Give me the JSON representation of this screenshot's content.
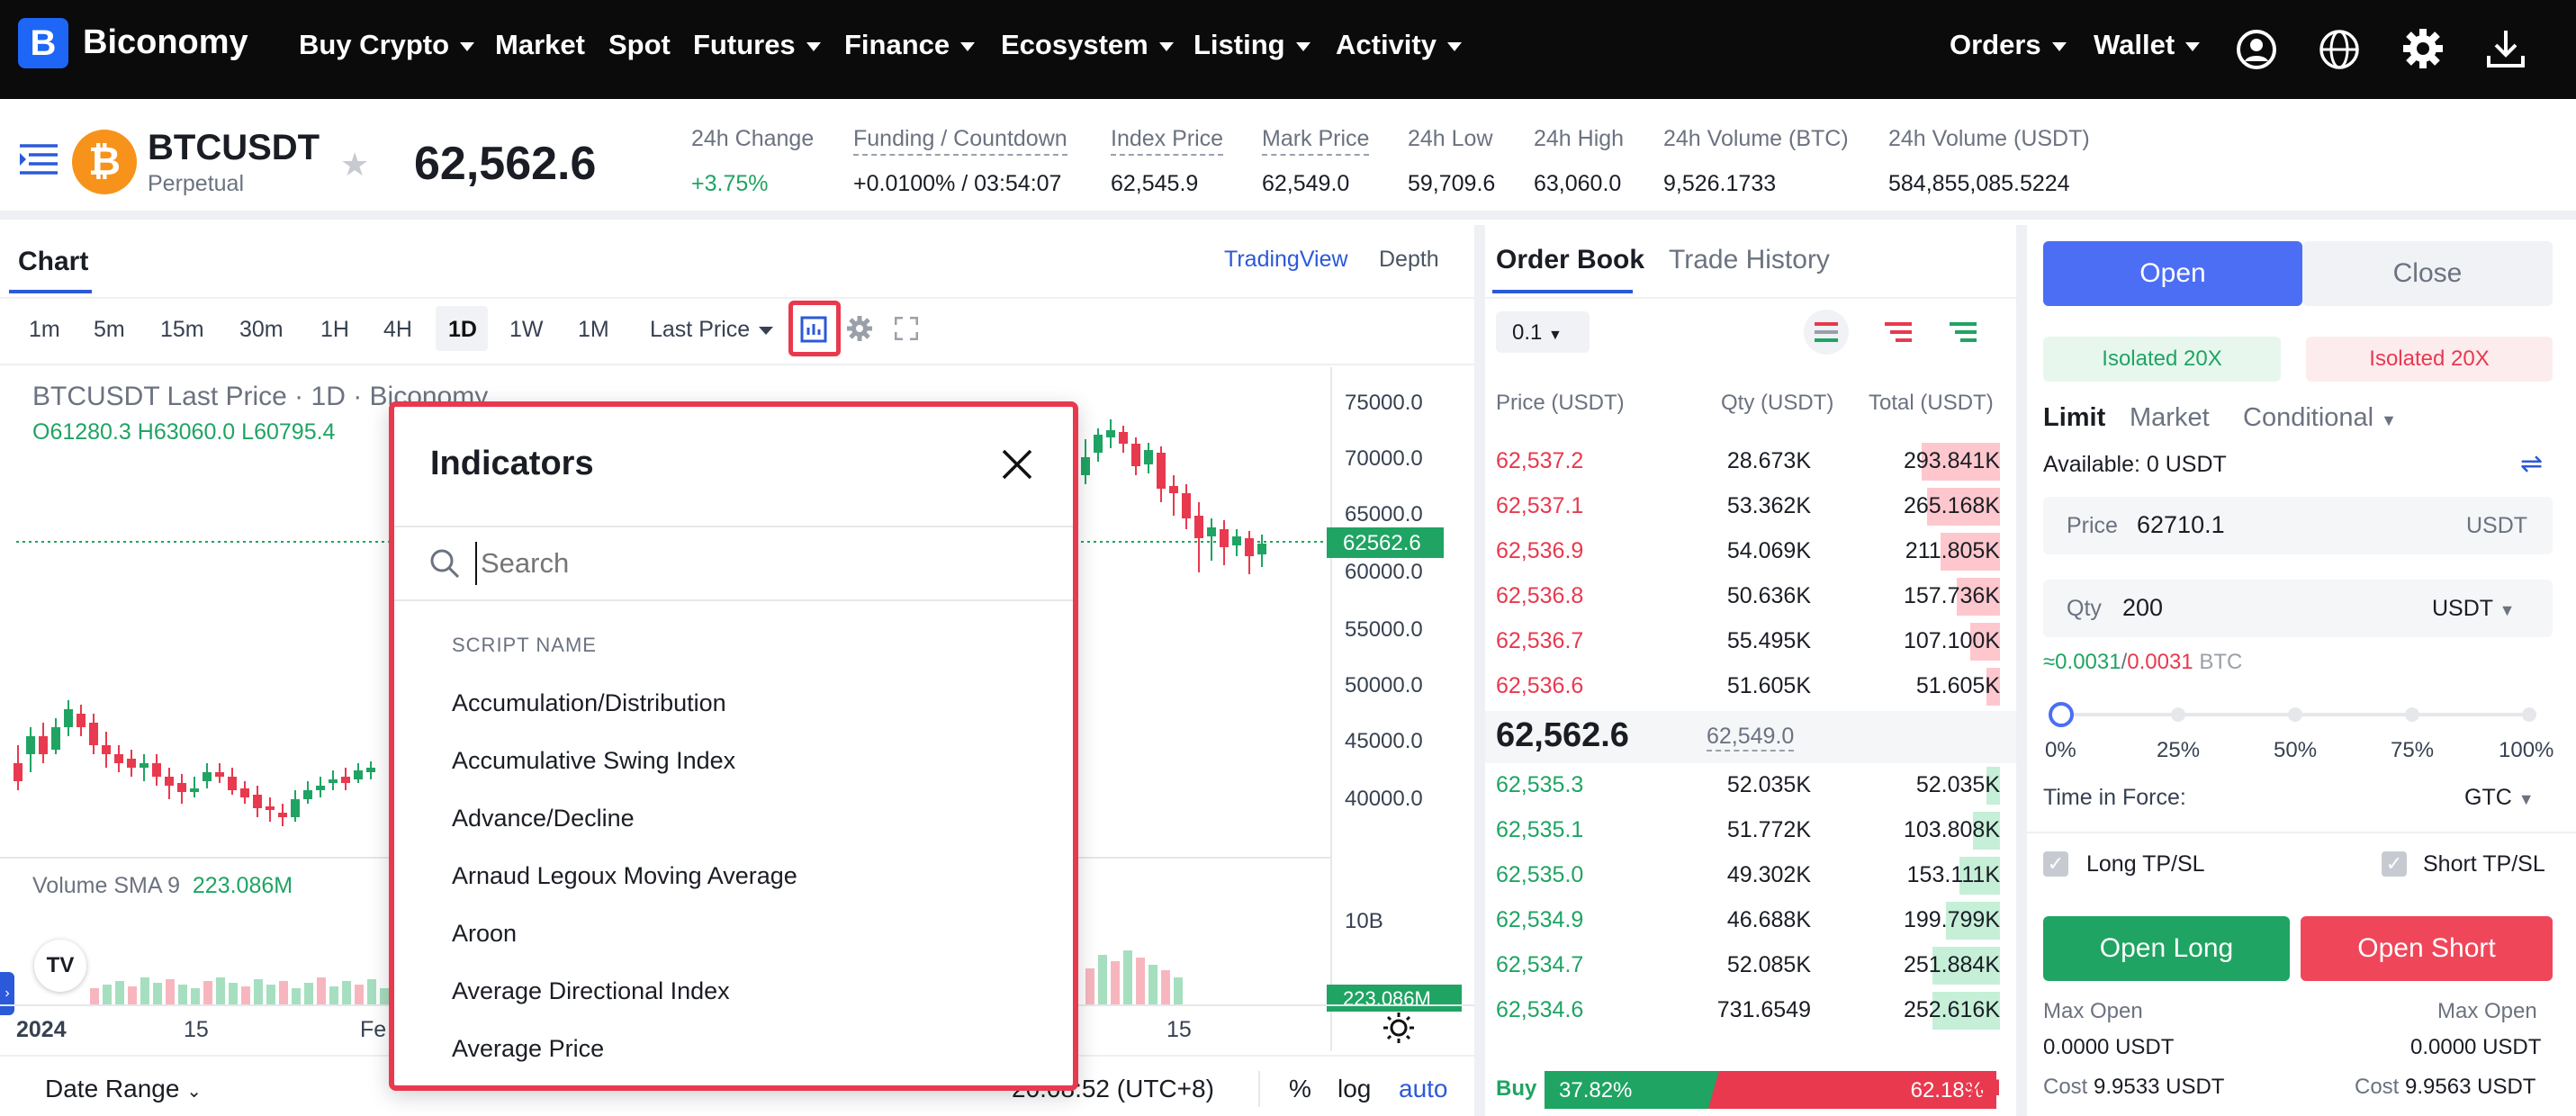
{
  "nav": {
    "brand": "Biconomy",
    "items": [
      "Buy Crypto",
      "Market",
      "Spot",
      "Futures",
      "Finance",
      "Ecosystem",
      "Listing",
      "Activity"
    ],
    "right": [
      "Orders",
      "Wallet"
    ]
  },
  "ticker": {
    "symbol": "BTCUSDT",
    "type": "Perpetual",
    "price": "62,562.6",
    "stats": [
      {
        "label": "24h Change",
        "value": "+3.75%"
      },
      {
        "label": "Funding / Countdown",
        "value": "+0.0100% / 03:54:07"
      },
      {
        "label": "Index Price",
        "value": "62,545.9"
      },
      {
        "label": "Mark Price",
        "value": "62,549.0"
      },
      {
        "label": "24h Low",
        "value": "59,709.6"
      },
      {
        "label": "24h High",
        "value": "63,060.0"
      },
      {
        "label": "24h Volume (BTC)",
        "value": "9,526.1733"
      },
      {
        "label": "24h Volume (USDT)",
        "value": "584,855,085.5224"
      }
    ]
  },
  "chart": {
    "tab": "Chart",
    "views": [
      "TradingView",
      "Depth"
    ],
    "timeframes": [
      "1m",
      "5m",
      "15m",
      "30m",
      "1H",
      "4H",
      "1D",
      "1W",
      "1M"
    ],
    "active_tf": "1D",
    "price_type": "Last Price",
    "legend": "BTCUSDT Last Price · 1D · Biconomy",
    "ohlc_o": "O61280.3",
    "ohlc_h": "H63060.0",
    "ohlc_l": "L60795.4",
    "axis": [
      "75000.0",
      "70000.0",
      "65000.0",
      "60000.0",
      "55000.0",
      "50000.0",
      "45000.0",
      "40000.0"
    ],
    "last_price_tag": "62562.6",
    "volume_label": "Volume SMA 9",
    "volume_value": "223.086M",
    "vol_axis": "10B",
    "vol_tag": "223.086M",
    "xaxis": [
      "2024",
      "15",
      "Fe",
      "15"
    ],
    "bottom_left": "Date Range",
    "time": "20:08:52 (UTC+8)",
    "pct": "%",
    "log": "log",
    "auto": "auto",
    "tv_logo": "TV"
  },
  "indicators": {
    "title": "Indicators",
    "search_placeholder": "Search",
    "section": "SCRIPT NAME",
    "items": [
      "Accumulation/Distribution",
      "Accumulative Swing Index",
      "Advance/Decline",
      "Arnaud Legoux Moving Average",
      "Aroon",
      "Average Directional Index",
      "Average Price"
    ]
  },
  "orderbook": {
    "tabs": [
      "Order Book",
      "Trade History"
    ],
    "precision": "0.1",
    "headers": [
      "Price (USDT)",
      "Qty (USDT)",
      "Total (USDT)"
    ],
    "asks": [
      [
        "62,537.2",
        "28.673K",
        "293.841K"
      ],
      [
        "62,537.1",
        "53.362K",
        "265.168K"
      ],
      [
        "62,536.9",
        "54.069K",
        "211.805K"
      ],
      [
        "62,536.8",
        "50.636K",
        "157.736K"
      ],
      [
        "62,536.7",
        "55.495K",
        "107.100K"
      ],
      [
        "62,536.6",
        "51.605K",
        "51.605K"
      ]
    ],
    "asks_depth": [
      0.29,
      0.27,
      0.22,
      0.16,
      0.11,
      0.05
    ],
    "mid": "62,562.6",
    "mid_mark": "62,549.0",
    "bids": [
      [
        "62,535.3",
        "52.035K",
        "52.035K"
      ],
      [
        "62,535.1",
        "51.772K",
        "103.808K"
      ],
      [
        "62,535.0",
        "49.302K",
        "153.111K"
      ],
      [
        "62,534.9",
        "46.688K",
        "199.799K"
      ],
      [
        "62,534.7",
        "52.085K",
        "251.884K"
      ],
      [
        "62,534.6",
        "731.6549",
        "252.616K"
      ]
    ],
    "bids_depth": [
      0.05,
      0.1,
      0.15,
      0.2,
      0.25,
      0.25
    ],
    "buy_label": "Buy",
    "buy_pct": "37.82%",
    "sell_pct": "62.18%",
    "sell_label": "Sell",
    "buy_ratio": 0.3782
  },
  "trade": {
    "open": "Open",
    "close": "Close",
    "iso_long": "Isolated 20X",
    "iso_short": "Isolated 20X",
    "types": [
      "Limit",
      "Market",
      "Conditional"
    ],
    "available_label": "Available:",
    "available": "0 USDT",
    "price_label": "Price",
    "price": "62710.1",
    "price_unit": "USDT",
    "qty_label": "Qty",
    "qty": "200",
    "qty_unit": "USDT",
    "conv_long": "≈0.0031",
    "conv_sep": "/",
    "conv_short": "0.0031",
    "conv_unit": "BTC",
    "slider": [
      "0%",
      "25%",
      "50%",
      "75%",
      "100%"
    ],
    "slider_value": 0,
    "tif_label": "Time in Force:",
    "tif": "GTC",
    "long_tpsl": "Long TP/SL",
    "short_tpsl": "Short TP/SL",
    "open_long": "Open Long",
    "open_short": "Open Short",
    "max_open_label": "Max Open",
    "max_open_long": "0.0000 USDT",
    "max_open_short": "0.0000 USDT",
    "cost_label": "Cost",
    "cost_long": "9.9533 USDT",
    "cost_short": "9.9563 USDT"
  },
  "colors": {
    "green": "#1fa463",
    "red": "#e8394e",
    "blue": "#4c6ef5",
    "accent": "#e8394e"
  }
}
